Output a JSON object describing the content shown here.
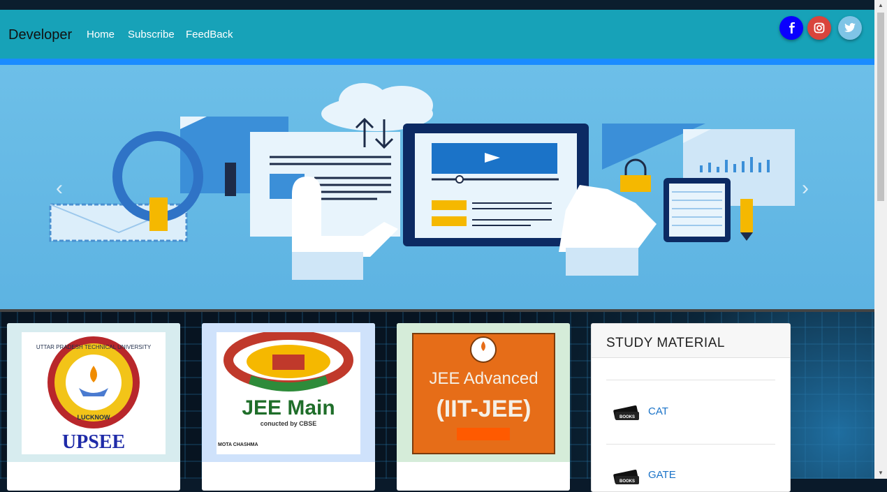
{
  "navbar": {
    "brand": "Developer",
    "links": [
      "Home",
      "Subscribe",
      "FeedBack"
    ],
    "social": [
      {
        "icon": "facebook-icon",
        "color": "#0a00ff"
      },
      {
        "icon": "instagram-icon",
        "color": "#d9443c"
      },
      {
        "icon": "twitter-icon",
        "color": "#7fc4e6"
      }
    ]
  },
  "colors": {
    "navbar": "#17a2b8",
    "accent_bar": "#1a8cff",
    "carousel": "#6dbfe8",
    "link": "#1a73c8"
  },
  "carousel": {
    "prev_label": "‹",
    "next_label": "›"
  },
  "cards": [
    {
      "title_text": "UPSEE",
      "logo_top": "UTTAR PRADESH TECHNICAL UNIVERSITY",
      "logo_bottom": "LUCKNOW",
      "bg": "#d7ecef"
    },
    {
      "title_text": "JEE Main",
      "sub": "conucted by CBSE",
      "brand": "MOTA CHASHMA",
      "bg": "#cfe2fb"
    },
    {
      "title_text": "JEE Advanced",
      "sub": "(IIT-JEE)",
      "bg": "#d5ecd9"
    }
  ],
  "study_material": {
    "title": "STUDY MATERIAL",
    "items": [
      "CAT",
      "GATE"
    ],
    "icon_text": "BOOKS"
  }
}
